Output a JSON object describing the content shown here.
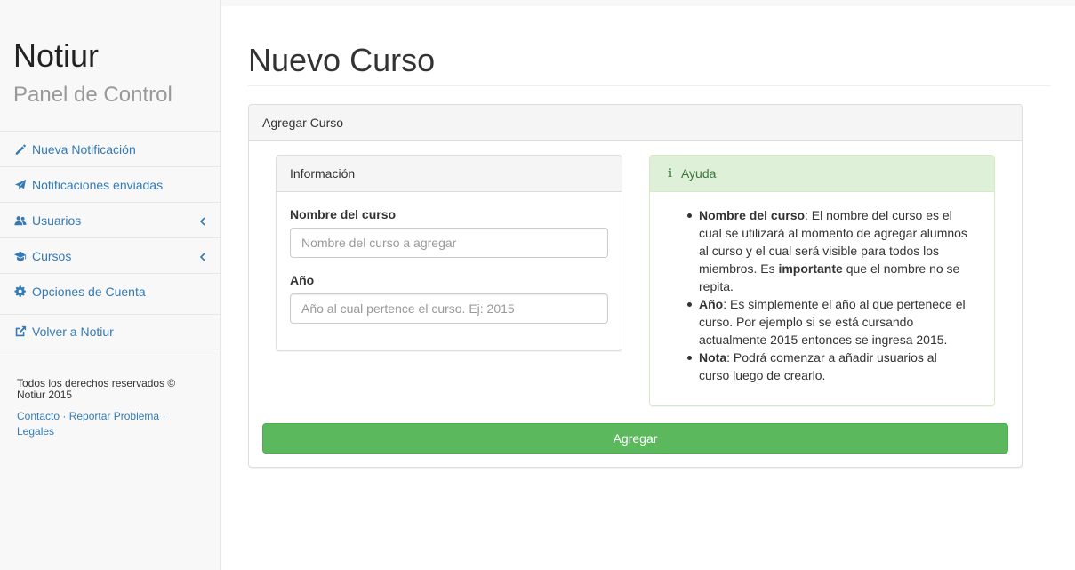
{
  "sidebar": {
    "brand": "Notiur",
    "subtitle": "Panel de Control",
    "items": [
      {
        "label": "Nueva Notificación",
        "icon": "pencil-icon"
      },
      {
        "label": "Notificaciones enviadas",
        "icon": "send-icon"
      },
      {
        "label": "Usuarios",
        "icon": "users-icon",
        "has_submenu": true
      },
      {
        "label": "Cursos",
        "icon": "graduation-cap-icon",
        "has_submenu": true
      },
      {
        "label": "Opciones de Cuenta",
        "icon": "gear-icon"
      },
      {
        "label": "Volver a Notiur",
        "icon": "external-link-icon"
      }
    ],
    "footer": {
      "copyright": "Todos los derechos reservados © Notiur 2015",
      "links": [
        "Contacto",
        "Reportar Problema",
        "Legales"
      ],
      "separator": "·"
    }
  },
  "main": {
    "page_title": "Nuevo Curso",
    "panel_title": "Agregar Curso",
    "info_panel": {
      "title": "Información",
      "course_name_label": "Nombre del curso",
      "course_name_placeholder": "Nombre del curso a agregar",
      "year_label": "Año",
      "year_placeholder": "Año al cual pertence el curso. Ej: 2015"
    },
    "help_panel": {
      "icon": "info-icon",
      "title": "Ayuda",
      "items": [
        {
          "bold": "Nombre del curso",
          "text_a": ": El nombre del curso es el cual se utilizará al momento de agregar alumnos al curso y el cual será visible para todos los miembros. Es ",
          "bold2": "importante",
          "text_b": " que el nombre no se repita."
        },
        {
          "bold": "Año",
          "text_a": ": Es simplemente el año al que pertenece el curso. Por ejemplo si se está cursando actualmente 2015 entonces se ingresa 2015."
        },
        {
          "bold": "Nota",
          "text_a": ": Podrá comenzar a añadir usuarios al curso luego de crearlo."
        }
      ]
    },
    "submit_label": "Agregar"
  },
  "colors": {
    "link": "#337ab7",
    "success": "#5cb85c",
    "help_header_bg": "#dff0d8",
    "help_text": "#3c763d"
  }
}
